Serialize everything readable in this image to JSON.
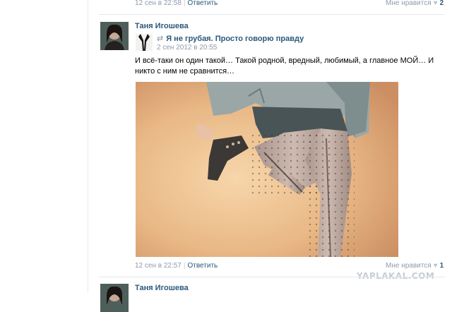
{
  "top_comment": {
    "date": "12 сен в 22:58",
    "reply": "Ответить",
    "like_label": "Мне нравится",
    "like_count": "2"
  },
  "post": {
    "author": "Таня Игошева",
    "repost": {
      "title": "Я не грубая. Просто говорю правду",
      "date": "2 сен 2012 в 20:55"
    },
    "text": "И всё-таки он один такой… Такой родной, вредный, любимый, а главное МОЙ… И никто с ним не сравнится…",
    "footer": {
      "date": "12 сен в 22:57",
      "reply": "Ответить",
      "like_label": "Мне нравится",
      "like_count": "1"
    }
  },
  "next_post": {
    "author": "Таня Игошева"
  },
  "watermark": "YAPLAKAL.COM"
}
